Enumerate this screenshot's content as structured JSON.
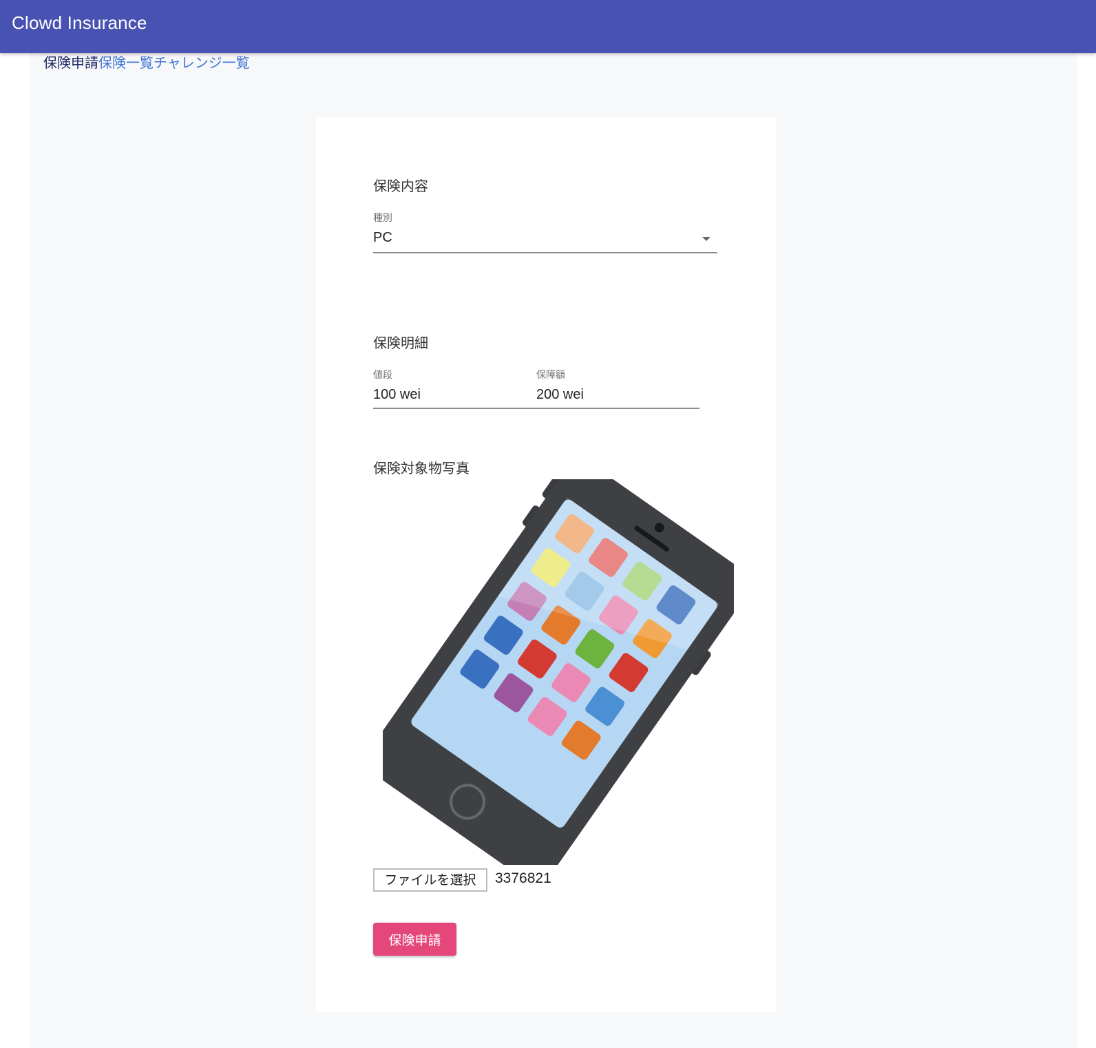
{
  "appbar": {
    "title": "Clowd Insurance",
    "color": "#4852b2"
  },
  "nav": {
    "items": [
      {
        "label": "保険申請",
        "active": true
      },
      {
        "label": "保険一覧",
        "active": false
      },
      {
        "label": "チャレンジ一覧",
        "active": false
      }
    ]
  },
  "form": {
    "content_section": {
      "title": "保険内容",
      "type_field": {
        "label": "種別",
        "value": "PC"
      }
    },
    "details_section": {
      "title": "保険明細",
      "price": {
        "label": "値段",
        "value": "100 wei"
      },
      "coverage": {
        "label": "保障額",
        "value": "200 wei"
      }
    },
    "photo_section": {
      "title": "保険対象物写真",
      "image_icon": "smartphone-illustration",
      "file_button_label": "ファイルを選択",
      "file_name": "3376821"
    },
    "submit_label": "保険申請",
    "submit_color": "#e4477a"
  }
}
